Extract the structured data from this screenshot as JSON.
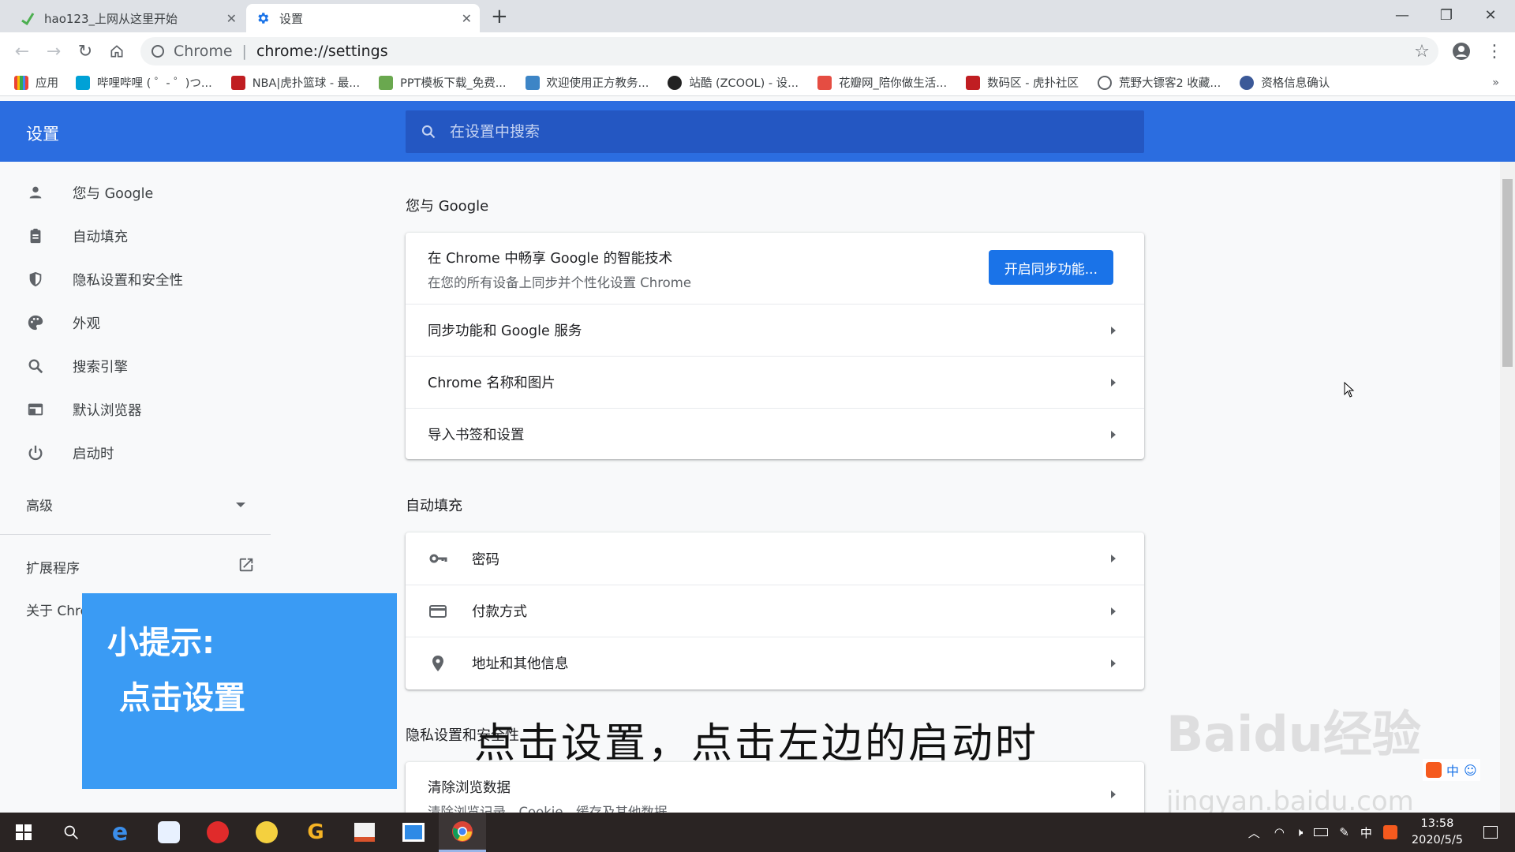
{
  "tabs": [
    {
      "label": "hao123_上网从这里开始"
    },
    {
      "label": "设置"
    }
  ],
  "omnibox": {
    "scheme": "Chrome",
    "url": "chrome://settings"
  },
  "bookmarks": [
    {
      "label": "应用"
    },
    {
      "label": "哔哩哔哩 ( ゜- ゜)つ..."
    },
    {
      "label": "NBA|虎扑篮球 - 最..."
    },
    {
      "label": "PPT模板下载_免费..."
    },
    {
      "label": "欢迎使用正方教务..."
    },
    {
      "label": "站酷 (ZCOOL) - 设..."
    },
    {
      "label": "花瓣网_陪你做生活..."
    },
    {
      "label": "数码区 - 虎扑社区"
    },
    {
      "label": "荒野大镖客2 收藏..."
    },
    {
      "label": "资格信息确认"
    }
  ],
  "settings": {
    "title": "设置",
    "search_placeholder": "在设置中搜索"
  },
  "sidebar": {
    "items": [
      {
        "label": "您与 Google",
        "icon": "person-icon"
      },
      {
        "label": "自动填充",
        "icon": "clipboard-icon"
      },
      {
        "label": "隐私设置和安全性",
        "icon": "shield-icon"
      },
      {
        "label": "外观",
        "icon": "palette-icon"
      },
      {
        "label": "搜索引擎",
        "icon": "search-icon"
      },
      {
        "label": "默认浏览器",
        "icon": "browser-icon"
      },
      {
        "label": "启动时",
        "icon": "power-icon"
      }
    ],
    "advanced": "高级",
    "extensions": "扩展程序",
    "about": "关于 Chro"
  },
  "sections": {
    "you_google": {
      "title": "您与 Google",
      "promo_title": "在 Chrome 中畅享 Google 的智能技术",
      "promo_sub": "在您的所有设备上同步并个性化设置 Chrome",
      "sync_button": "开启同步功能...",
      "rows": [
        "同步功能和 Google 服务",
        "Chrome 名称和图片",
        "导入书签和设置"
      ]
    },
    "autofill": {
      "title": "自动填充",
      "rows": [
        "密码",
        "付款方式",
        "地址和其他信息"
      ]
    },
    "privacy": {
      "title": "隐私设置和安全性",
      "row_title": "清除浏览数据",
      "row_sub": "清除浏览记录、Cookie、缓存及其他数据"
    }
  },
  "overlay": {
    "tip_line1": "小提示:",
    "tip_line2": "点击设置",
    "caption": "点击设置，点击左边的启动时",
    "watermark": "Baidu经验",
    "watermark_url": "jingyan.baidu.com",
    "ime": "中"
  },
  "taskbar": {
    "time": "13:58",
    "date": "2020/5/5",
    "ime_lang": "中"
  },
  "colors": {
    "header_blue": "#2b6de0",
    "button_blue": "#1a73e8",
    "tip_blue": "#3a9bf4"
  }
}
